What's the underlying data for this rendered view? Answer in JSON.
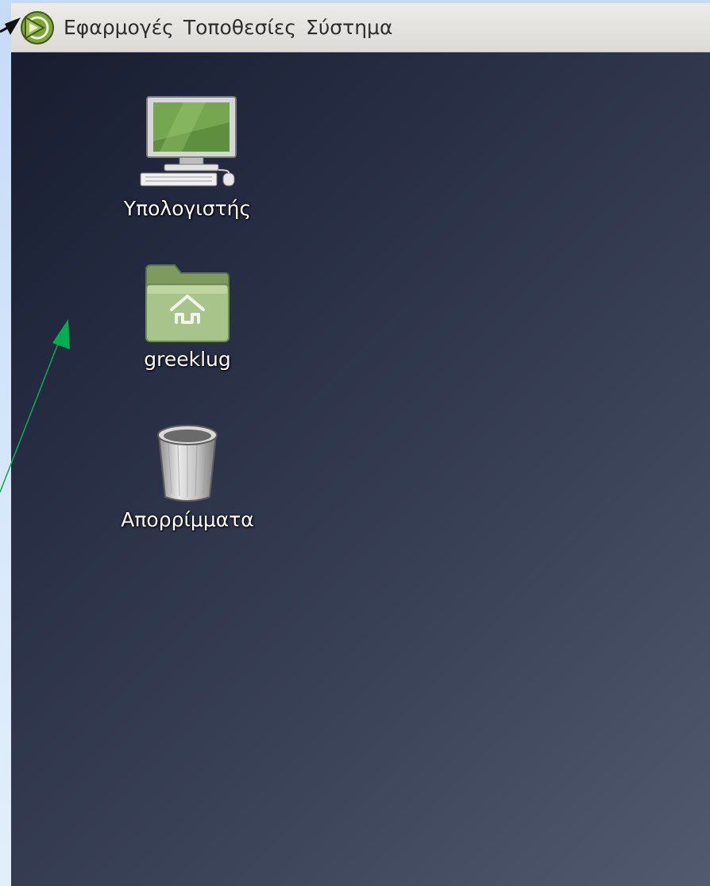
{
  "panel": {
    "logo_icon": "distributor-logo-icon",
    "menus": [
      {
        "label": "Εφαρμογές"
      },
      {
        "label": "Τοποθεσίες"
      },
      {
        "label": "Σύστημα"
      }
    ]
  },
  "desktop": {
    "icons": [
      {
        "label": "Υπολογιστής",
        "icon": "computer-icon"
      },
      {
        "label": "greeklug",
        "icon": "home-folder-icon"
      },
      {
        "label": "Απορρίμματα",
        "icon": "trash-icon"
      }
    ]
  },
  "colors": {
    "panel_bg": "#e4e3df",
    "desktop_top_left": "#161b2c",
    "desktop_bottom_right": "#525a70",
    "annotation_arrow": "#00b050",
    "backdrop": "#cfe0f7"
  }
}
